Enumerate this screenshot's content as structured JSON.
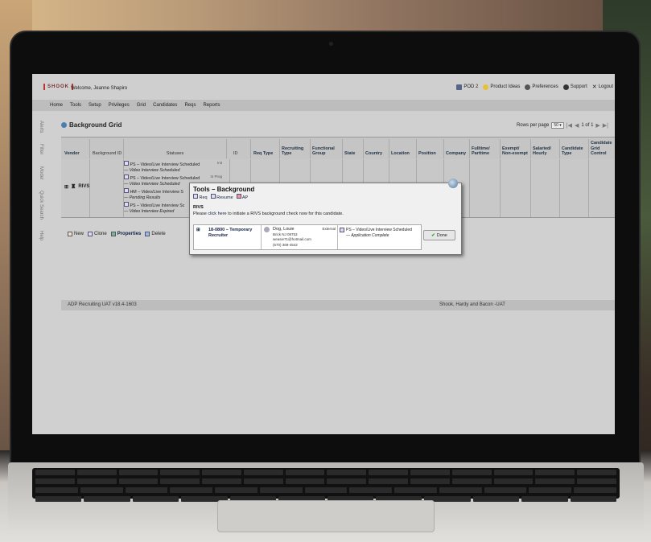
{
  "app": {
    "logo": "SHOOK",
    "welcome": "Welcome, Jeanne Shapiro",
    "topright": [
      "POD 2",
      "Product Ideas",
      "Preferences",
      "Support",
      "Logout"
    ]
  },
  "nav": [
    "Home",
    "Tools",
    "Setup",
    "Privileges",
    "Grid",
    "Candidates",
    "Reqs",
    "Reports"
  ],
  "sidebar": [
    "Alerts",
    "Filter",
    "Model",
    "Quick Search",
    "Help"
  ],
  "grid": {
    "title": "Background Grid",
    "rows_label": "Rows per page",
    "rows_value": "50 ▾",
    "page_info": "1 of 1",
    "columns": [
      "Vendor",
      "Background ID",
      "Statuses",
      "ID",
      "Req Type",
      "Recruiting Type",
      "Functional Group",
      "State",
      "Country",
      "Location",
      "Position",
      "Company",
      "Fulltime/ Parttime",
      "Exempt/ Non-exempt",
      "Salaried/ Hourly",
      "Candidate Type",
      "Candidate Grid Control"
    ],
    "row": {
      "vendor": "RIVS",
      "statuses": [
        {
          "line1": "PS – Video/Live Interview Scheduled",
          "line2": "— Video Interview Scheduled",
          "tag": "Init"
        },
        {
          "line1": "PS – Video/Live Interview Scheduled",
          "line2": "— Video Interview Scheduled",
          "tag": "In Prog"
        },
        {
          "line1": "HM – Video/Live Interview S",
          "line2": "— Pending Results",
          "tag": ""
        },
        {
          "line1": "PS – Video/Live Interview Sc",
          "line2": "— Video Interview Expired",
          "tag": ""
        }
      ]
    },
    "actions": [
      "New",
      "Clone",
      "Properties",
      "Delete"
    ]
  },
  "footer": {
    "left": "ADP Recruiting UAT v18.4-1603",
    "right": "Shook, Hardy and Bacon -UAT"
  },
  "popup": {
    "title": "Tools – Background",
    "links": [
      "Req",
      "Resume",
      "AP"
    ],
    "section": "RIVS",
    "msg_pre": "Please ",
    "msg_link": "click here",
    "msg_post": " to initiate a RIVS background check now for this candidate.",
    "req": "18-0800 – Temporary Recruiter",
    "cand_name": "Dog, Louie",
    "cand_city": "Brick NJ 08753",
    "cand_email": "weasie71@hotmail.com",
    "cand_phone": "(570) 369-4542",
    "cand_type": "External",
    "status1": "PS – Video/Live Interview Scheduled",
    "status2": "— Application Complete",
    "done": "Done"
  }
}
